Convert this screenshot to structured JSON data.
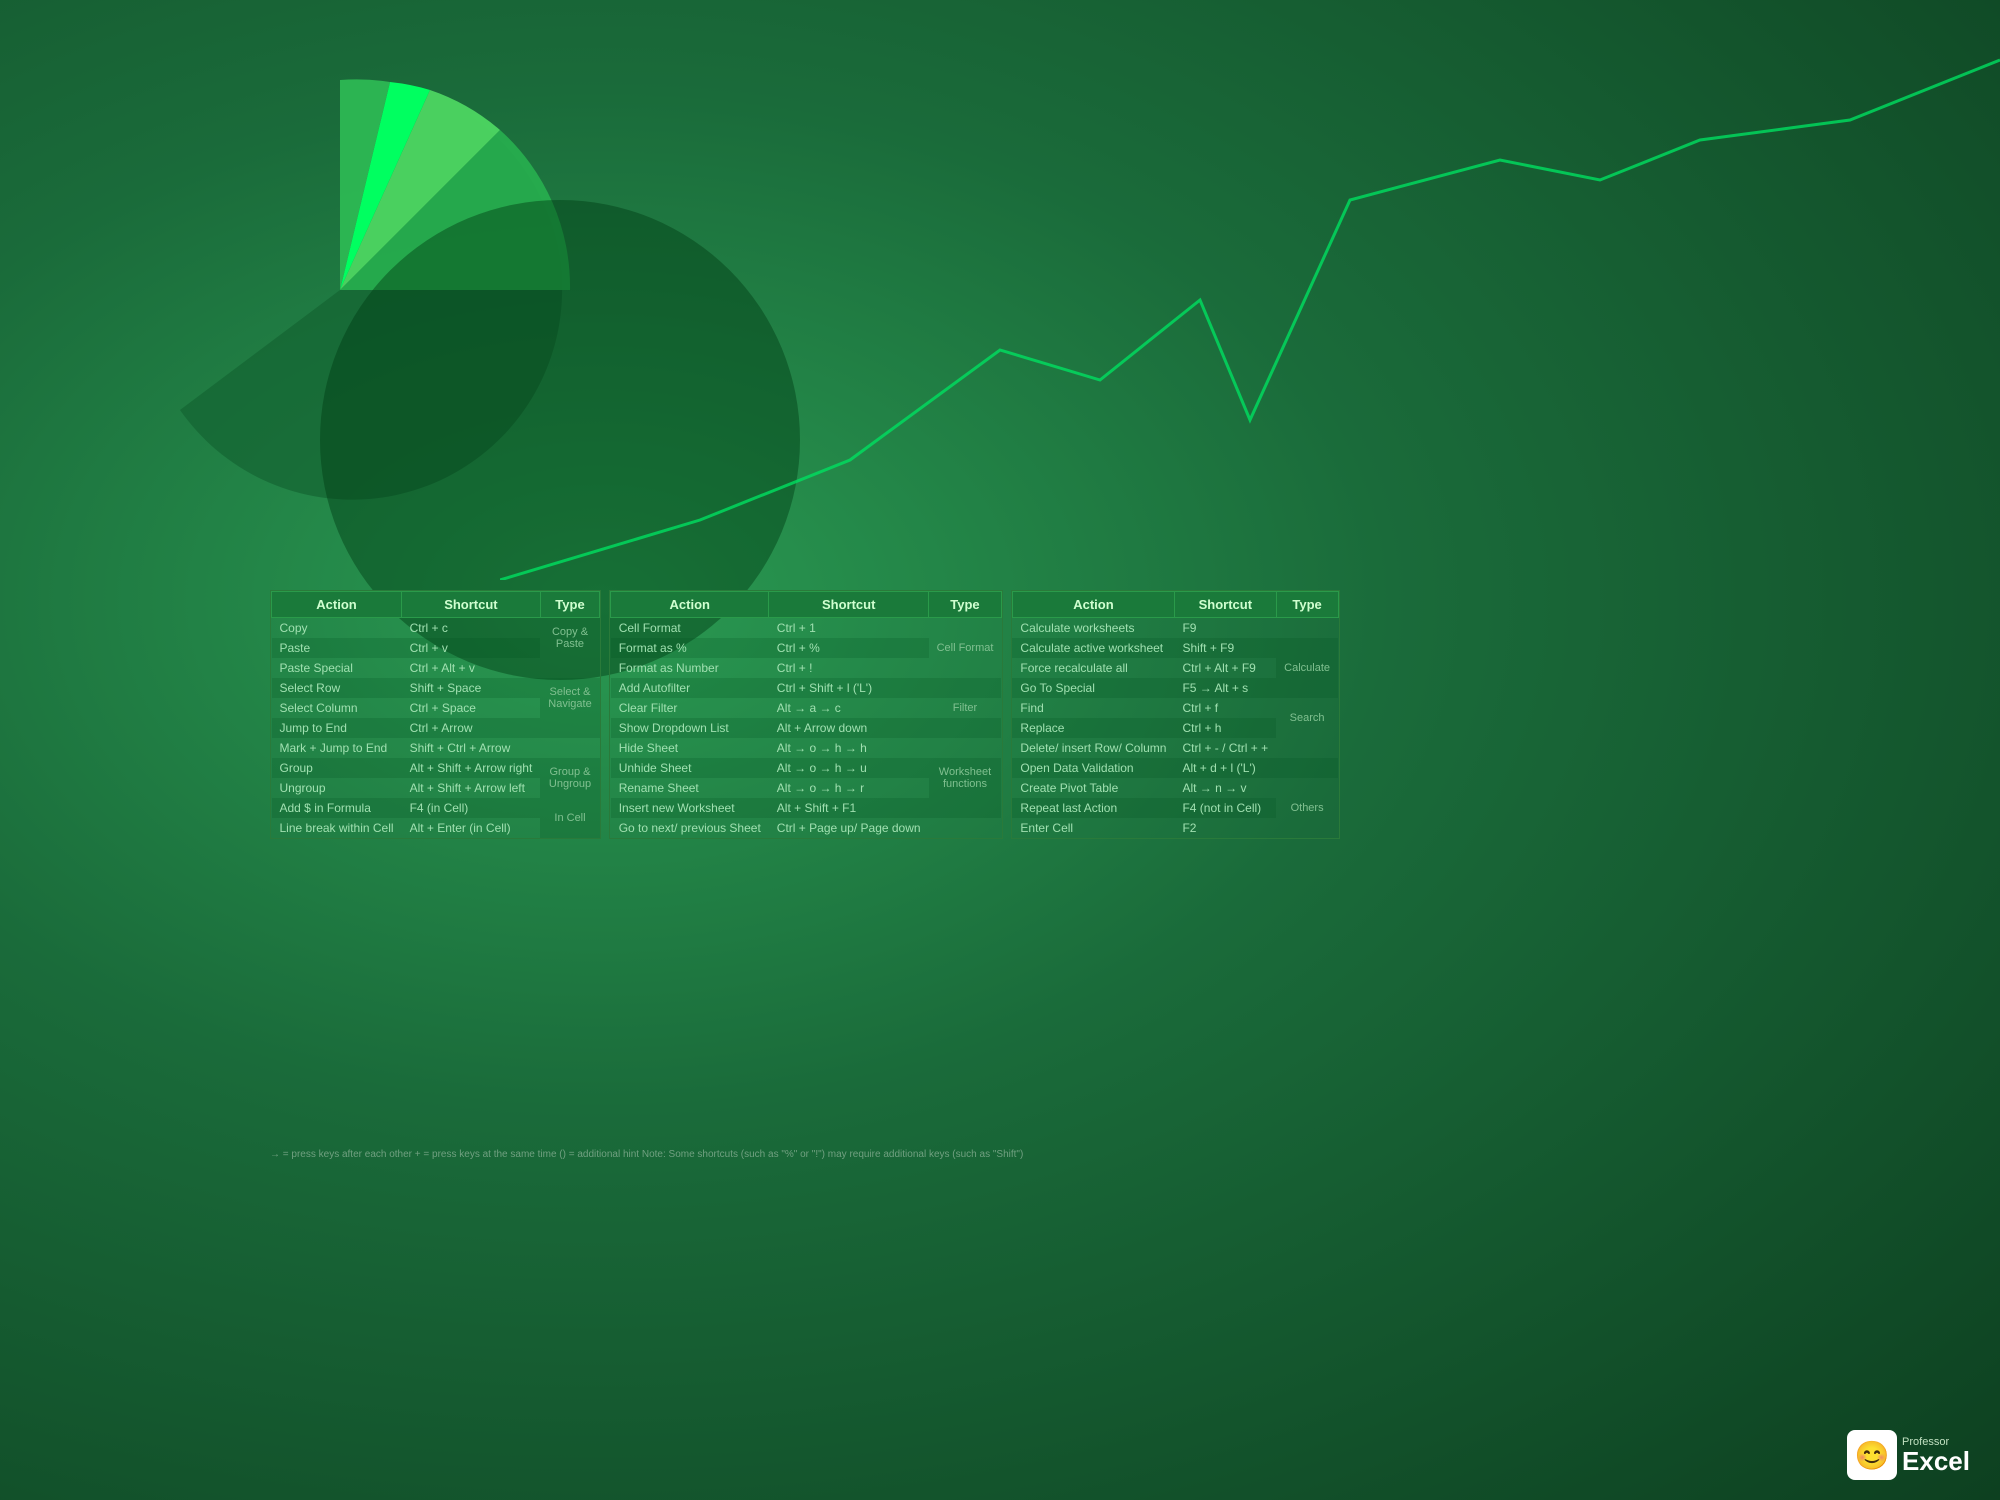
{
  "background": {
    "color": "#1a6b3a"
  },
  "table1": {
    "headers": [
      "Action",
      "Shortcut",
      "Type"
    ],
    "rows": [
      [
        "Copy",
        "Ctrl + c",
        ""
      ],
      [
        "Paste",
        "Ctrl + v",
        "Copy &"
      ],
      [
        "Paste Special",
        "Ctrl + Alt + v",
        "Paste"
      ],
      [
        "Select Row",
        "Shift + Space",
        ""
      ],
      [
        "Select Column",
        "Ctrl + Space",
        "Select &"
      ],
      [
        "Jump to End",
        "Ctrl + Arrow",
        "Navigate"
      ],
      [
        "Mark + Jump to End",
        "Shift + Ctrl + Arrow",
        ""
      ],
      [
        "Group",
        "Alt + Shift + Arrow right",
        "Group &"
      ],
      [
        "Ungroup",
        "Alt + Shift + Arrow left",
        "Ungroup"
      ],
      [
        "Add $ in Formula",
        "F4 (in Cell)",
        "In Cell"
      ],
      [
        "Line break within Cell",
        "Alt + Enter (in Cell)",
        ""
      ]
    ]
  },
  "table2": {
    "headers": [
      "Action",
      "Shortcut",
      "Type"
    ],
    "rows": [
      [
        "Cell Format",
        "Ctrl + 1",
        ""
      ],
      [
        "Format as %",
        "Ctrl + %",
        "Cell Format"
      ],
      [
        "Format as Number",
        "Ctrl + !",
        ""
      ],
      [
        "Add Autofilter",
        "Ctrl + Shift + l ('L')",
        ""
      ],
      [
        "Clear Filter",
        "Alt → a → c",
        "Filter"
      ],
      [
        "Show Dropdown List",
        "Alt + Arrow down",
        ""
      ],
      [
        "Hide Sheet",
        "Alt → o → h → h",
        ""
      ],
      [
        "Unhide Sheet",
        "Alt → o → h → u",
        "Worksheet"
      ],
      [
        "Rename Sheet",
        "Alt → o → h → r",
        "functions"
      ],
      [
        "Insert new Worksheet",
        "Alt + Shift + F1",
        ""
      ],
      [
        "Go to next/ previous Sheet",
        "Ctrl + Page up/ Page down",
        ""
      ]
    ]
  },
  "table3": {
    "headers": [
      "Action",
      "Shortcut",
      "Type"
    ],
    "rows": [
      [
        "Calculate worksheets",
        "F9",
        ""
      ],
      [
        "Calculate active worksheet",
        "Shift + F9",
        "Calculate"
      ],
      [
        "Force recalculate all",
        "Ctrl + Alt + F9",
        ""
      ],
      [
        "Go To Special",
        "F5 → Alt + s",
        ""
      ],
      [
        "Find",
        "Ctrl + f",
        "Search"
      ],
      [
        "Replace",
        "Ctrl + h",
        ""
      ],
      [
        "Delete/ insert Row/ Column",
        "Ctrl + - / Ctrl + +",
        ""
      ],
      [
        "Open Data Validation",
        "Alt + d + l ('L')",
        ""
      ],
      [
        "Create Pivot Table",
        "Alt → n → v",
        "Others"
      ],
      [
        "Repeat last Action",
        "F4 (not in Cell)",
        ""
      ],
      [
        "Enter Cell",
        "F2",
        ""
      ]
    ]
  },
  "footnote": "→ = press keys after each other     + = press keys at the same time     () = additional hint     Note: Some shortcuts (such as \"%\" or \"!\") may require additional keys (such as \"Shift\")",
  "logo": {
    "professor": "Professor",
    "excel": "Excel"
  }
}
